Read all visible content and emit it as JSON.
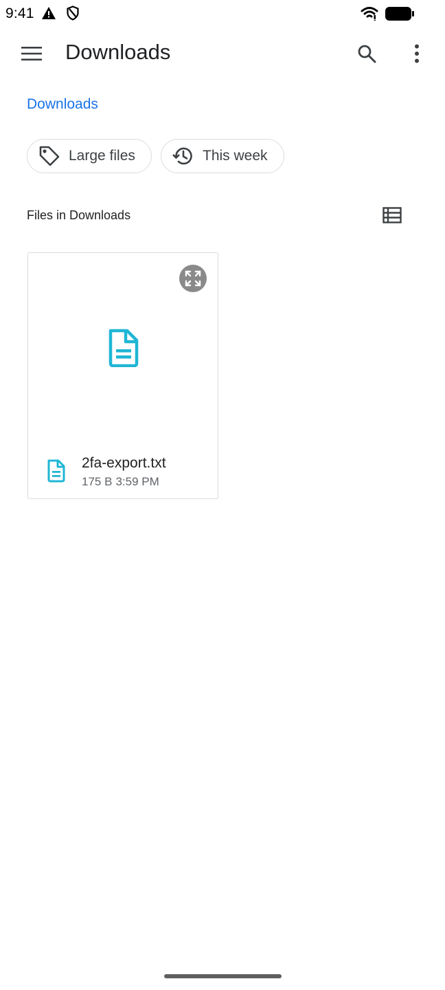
{
  "status_bar": {
    "time": "9:41",
    "icons": [
      "alert-icon",
      "shield-icon",
      "wifi-icon",
      "battery-icon"
    ]
  },
  "app_bar": {
    "title": "Downloads",
    "icons": [
      "menu-icon",
      "search-icon",
      "more-vert-icon"
    ]
  },
  "breadcrumb": {
    "label": "Downloads"
  },
  "chips": [
    {
      "label": "Large files",
      "icon": "tag-icon"
    },
    {
      "label": "This week",
      "icon": "history-icon"
    }
  ],
  "section": {
    "title": "Files in Downloads",
    "view_toggle_icon": "list-view-icon"
  },
  "files": [
    {
      "name": "2fa-export.txt",
      "size": "175 B",
      "time": "3:59 PM",
      "icon": "document-icon",
      "accent_color": "#1fb6d5"
    }
  ],
  "colors": {
    "link": "#1a73e8",
    "doc_icon": "#1fb6d5"
  }
}
